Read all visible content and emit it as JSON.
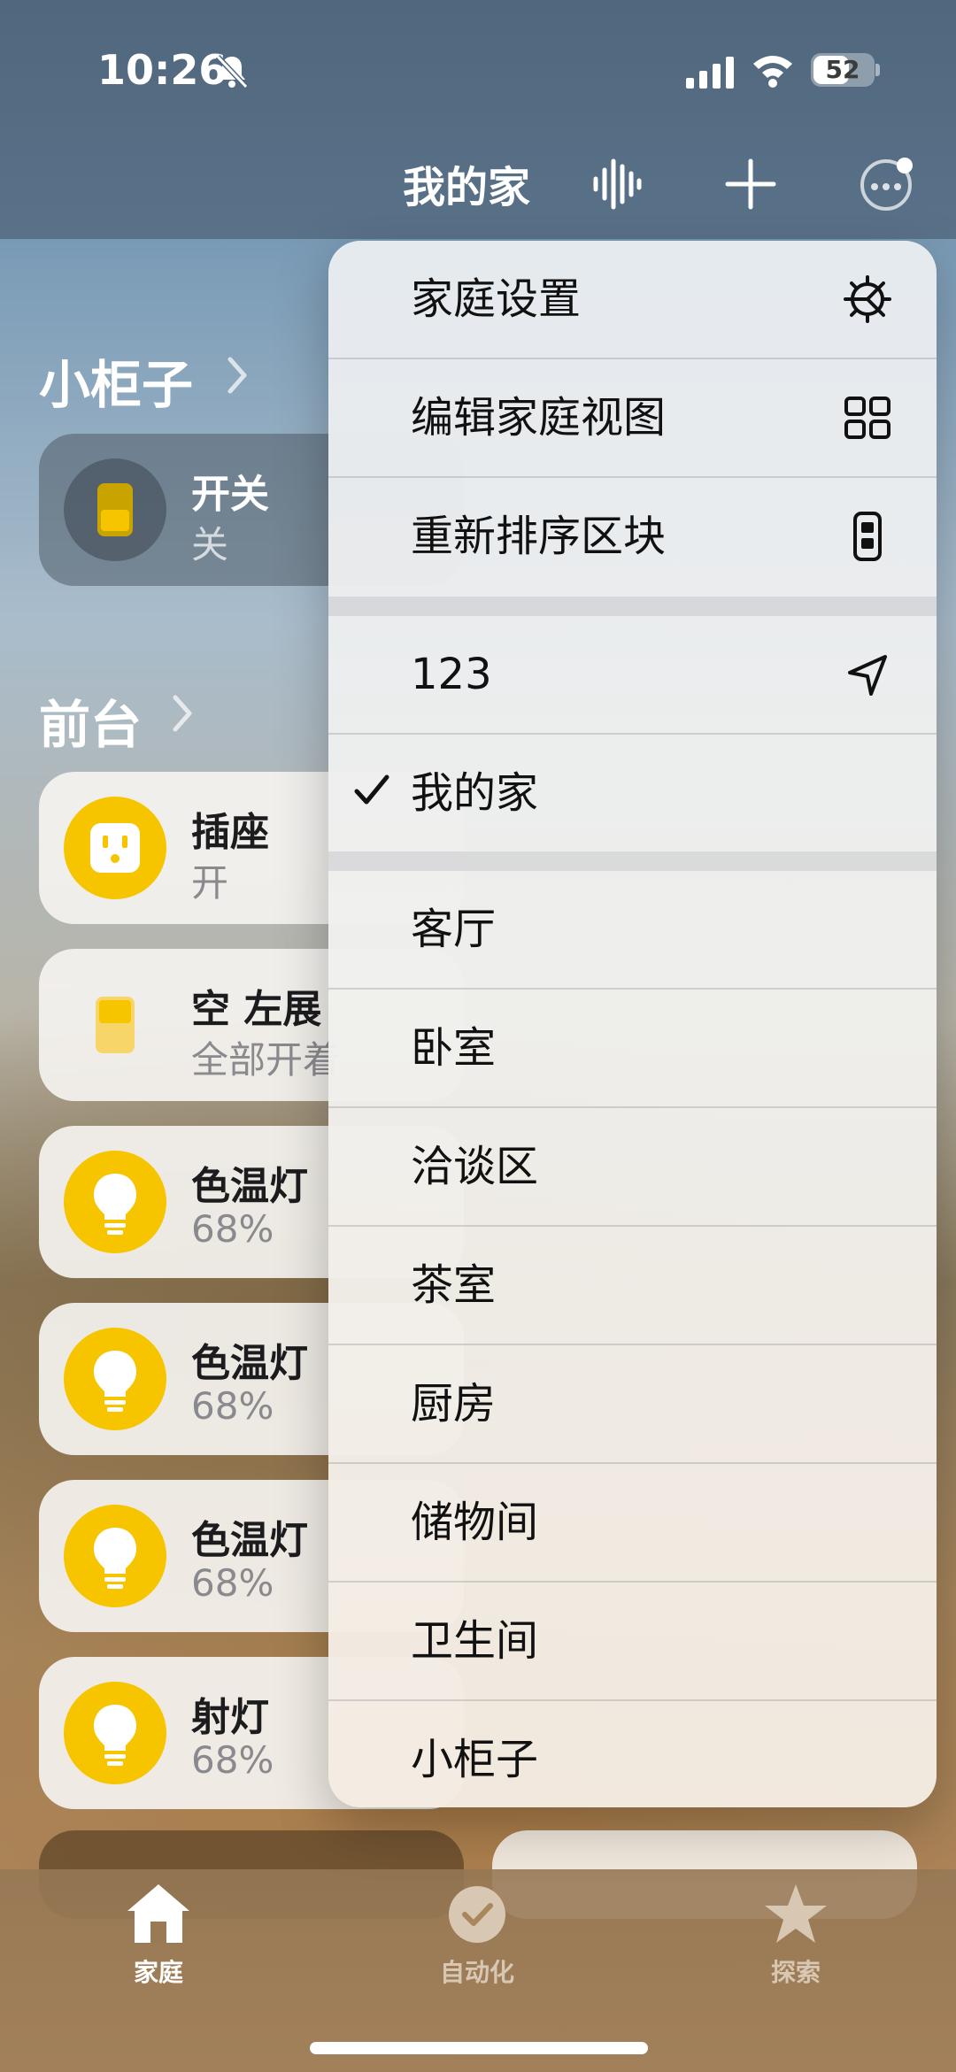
{
  "status_bar": {
    "time": "10:26",
    "battery": "52"
  },
  "header": {
    "title": "我的家"
  },
  "sections": [
    {
      "title": "小柜子",
      "tiles": [
        {
          "name": "开关",
          "state": "关",
          "icon": "switch-icon"
        }
      ]
    },
    {
      "title": "前台",
      "tiles": [
        {
          "name": "插座",
          "state": "开",
          "icon": "outlet-icon"
        },
        {
          "name": "空 左展",
          "state": "全部开着",
          "icon": "switch-icon"
        },
        {
          "name": "色温灯",
          "state": "68%",
          "icon": "lightbulb-icon"
        },
        {
          "name": "色温灯",
          "state": "68%",
          "icon": "lightbulb-icon"
        },
        {
          "name": "色温灯",
          "state": "68%",
          "icon": "lightbulb-icon"
        },
        {
          "name": "射灯",
          "state": "68%",
          "icon": "lightbulb-icon"
        }
      ]
    }
  ],
  "menu": {
    "settings_items": [
      {
        "label": "家庭设置",
        "icon": "gear-icon"
      },
      {
        "label": "编辑家庭视图",
        "icon": "grid-icon"
      },
      {
        "label": "重新排序区块",
        "icon": "reorder-icon"
      }
    ],
    "homes": [
      {
        "label": "123",
        "icon": "location-arrow-icon",
        "selected": false
      },
      {
        "label": "我的家",
        "icon": "",
        "selected": true
      }
    ],
    "rooms": [
      "客厅",
      "卧室",
      "洽谈区",
      "茶室",
      "厨房",
      "储物间",
      "卫生间",
      "小柜子"
    ]
  },
  "tabbar": {
    "tabs": [
      {
        "label": "家庭",
        "icon": "house-icon",
        "active": true
      },
      {
        "label": "自动化",
        "icon": "clock-check-icon",
        "active": false
      },
      {
        "label": "探索",
        "icon": "star-icon",
        "active": false
      }
    ]
  },
  "colors": {
    "accent_yellow": "#f6c500",
    "tab_active": "#ffffff",
    "tab_inactive": "#d8c7b2"
  }
}
